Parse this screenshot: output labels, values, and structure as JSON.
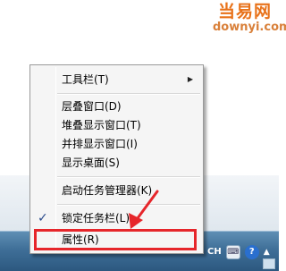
{
  "watermark": {
    "brand": "当易网",
    "domain": "downyi.com"
  },
  "menu": {
    "items": [
      {
        "label": "工具栏(T)",
        "submenu": true
      },
      {
        "label": "层叠窗口(D)"
      },
      {
        "label": "堆叠显示窗口(T)"
      },
      {
        "label": "并排显示窗口(I)"
      },
      {
        "label": "显示桌面(S)"
      },
      {
        "label": "启动任务管理器(K)"
      },
      {
        "label": "锁定任务栏(L)",
        "checked": true
      },
      {
        "label": "属性(R)"
      }
    ],
    "check_glyph": "✓",
    "submenu_glyph": "▶"
  },
  "tray": {
    "language": "CH",
    "help": "?",
    "expand": "▲"
  },
  "annotation": {
    "color": "#e6262b",
    "target": "属性(R)"
  }
}
